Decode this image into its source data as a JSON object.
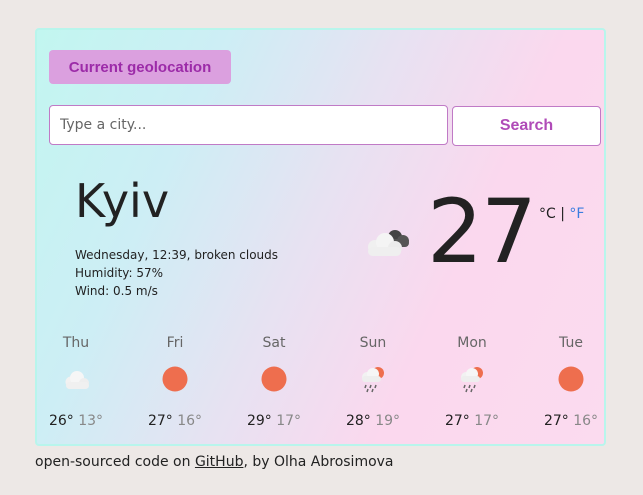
{
  "search": {
    "geolocation_label": "Current geolocation",
    "placeholder": "Type a city...",
    "button_label": "Search"
  },
  "current": {
    "city": "Kyiv",
    "datetime_description": "Wednesday, 12:39, broken clouds",
    "humidity": "Humidity: 57%",
    "wind": "Wind: 0.5 m/s",
    "temperature": "27",
    "icon": "broken-clouds-icon",
    "unit_celsius": "°C",
    "unit_separator": "|",
    "unit_fahrenheit": "°F"
  },
  "forecast": [
    {
      "day": "Thu",
      "icon": "few-clouds-icon",
      "max": "26°",
      "min": "13°"
    },
    {
      "day": "Fri",
      "icon": "clear-sky-icon",
      "max": "27°",
      "min": "16°"
    },
    {
      "day": "Sat",
      "icon": "clear-sky-icon",
      "max": "29°",
      "min": "17°"
    },
    {
      "day": "Sun",
      "icon": "rain-icon",
      "max": "28°",
      "min": "19°"
    },
    {
      "day": "Mon",
      "icon": "rain-icon",
      "max": "27°",
      "min": "17°"
    },
    {
      "day": "Tue",
      "icon": "clear-sky-icon",
      "max": "27°",
      "min": "16°"
    }
  ],
  "footer": {
    "prefix": "open-sourced code on",
    "link": "GitHub",
    "suffix": ", by Olha Abrosimova"
  },
  "colors": {
    "accent": "#b04bb8",
    "geo_button_bg": "#dba0df",
    "unit_link": "#3b7de0",
    "sun": "#ee6e4e"
  }
}
